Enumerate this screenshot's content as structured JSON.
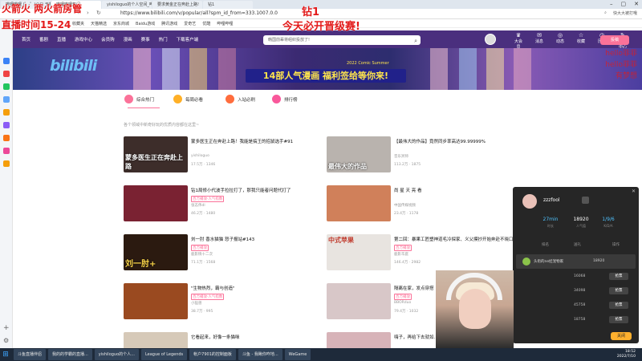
{
  "overlay": {
    "line1": "火箭火 两火箭房管",
    "line2": "直播时间15-24",
    "center1": "钻1",
    "center2": "今天必开晋级赛!",
    "watermark": [
      "hello菲菲",
      "hello菲菲",
      "有梦想"
    ]
  },
  "browser": {
    "tabs": [
      "哔哩哔哩 (゜-゜)つロ 干杯~-bilibili",
      "哔哩哔哩热门",
      "yishiloguo的个人空间_哔哩哔哩",
      "要求黄金正在奔赴上路!",
      "钻1"
    ],
    "url": "https://www.bilibili.com/v/popular/all?spm_id_from=333.1007.0.0",
    "user": "快大大被打哦",
    "bookmarks": [
      "收藏夹",
      "天猫精选",
      "京东商城",
      "Baidu游戏",
      "腾讯游戏",
      "爱奇艺",
      "优酷",
      "哔哩哔哩"
    ]
  },
  "bili": {
    "nav": [
      "首页",
      "番剧",
      "直播",
      "游戏中心",
      "会员购",
      "漫画",
      "赛事",
      "热门",
      "下载客户端"
    ],
    "search_placeholder": "韩国前辈将组织投放了!",
    "header_icons": [
      "大会员",
      "消息",
      "动态",
      "收藏",
      "历史",
      "创作中心"
    ],
    "upload": "投稿",
    "logo": "bilibili",
    "banner_slogan": "14部人气漫画 福利签给等你来!",
    "banner_small": "2022 Comic Summer",
    "categories": [
      {
        "label": "综合热门",
        "color": "#fb7299"
      },
      {
        "label": "每周必看",
        "color": "#ffb027"
      },
      {
        "label": "入站必刷",
        "color": "#ff6d3d"
      },
      {
        "label": "排行榜",
        "color": "#f9589b"
      }
    ],
    "hint": "各个领域中新奇好玩的优质内容都在这里~"
  },
  "cards": [
    {
      "title": "蒙多医生正在奔赴上路！我能是搞王的招鼠选手#91",
      "thumb": "蒙多医生正在奔赴上路",
      "tag": "",
      "up": "yishiloguo",
      "stat": "17.5万 · 1346",
      "color": "#3d2d2a"
    },
    {
      "title": "【最伟大的作品】竟然同步率高达99.99999%",
      "thumb": "最伟大的作品",
      "tag": "",
      "up": "音乐冥师",
      "stat": "113.2万 · 1875",
      "color": "#b9b3ae"
    },
    {
      "title": "钻1局修小代波手拉拉打了，那我只能者问题代打了",
      "thumb": "",
      "tag": "百万播放·人气指数",
      "up": "张志伟dl",
      "stat": "46.2万 · 1480",
      "color": "#7a2232"
    },
    {
      "title": "尚 星 天 亮 看",
      "thumb": "",
      "tag": "",
      "up": "中国传媒视频",
      "stat": "23.4万 · 1178",
      "color": "#d0805a"
    },
    {
      "title": "刘一肘 香水猫猫 怒子报站#143",
      "thumb": "刘一肘+",
      "tag": "百万播放",
      "up": "鹿影情十二次",
      "stat": "71.1万 · 1568",
      "color": "#2b1a10"
    },
    {
      "title": "第二回：暴果工匠塑神道毛冷探家、义父摸抄开始奔赴不晓口",
      "thumb": "中式苹果",
      "tag": "百万播放",
      "up": "鹿影华庭",
      "stat": "146.4万 · 2982",
      "color": "#e8e4e0"
    },
    {
      "title": "\"生物热烈，霸与创造\"",
      "thumb": "",
      "tag": "百万播放·人气指数",
      "up": "小猛兽",
      "stat": "38.7万 · 995",
      "color": "#9a4a20"
    },
    {
      "title": "隔离在家，发点穿搭",
      "thumb": "",
      "tag": "百万播放",
      "up": "BBORduo",
      "stat": "79.4万 · 1032",
      "color": "#d8c7c8"
    },
    {
      "title": "它看起来，好像一条猫咪",
      "thumb": "",
      "tag": "",
      "up": "",
      "stat": "",
      "color": "#d6c9b8"
    },
    {
      "title": "嗨子，再给下去就如...",
      "thumb": "",
      "tag": "",
      "up": "",
      "stat": "",
      "color": "#d7b3b8"
    }
  ],
  "chat": {
    "username": "zzzfool",
    "stats": [
      {
        "value": "27min",
        "label": "时长"
      },
      {
        "value": "18920",
        "label": "人气值"
      },
      {
        "value": "1/9/6",
        "label": "K/D/A"
      }
    ],
    "columns": [
      "排名",
      "",
      "送礼",
      "",
      "操作"
    ],
    "first": {
      "text": "头衔的ne娃宠物家",
      "num": "18920"
    },
    "rows": [
      {
        "num": "16068",
        "btn": "抢票"
      },
      {
        "num": "34098",
        "btn": "抢票"
      },
      {
        "num": "45758",
        "btn": "抢票"
      },
      {
        "num": "18758",
        "btn": "抢票"
      }
    ],
    "send": "关闭"
  },
  "taskbar": {
    "items": [
      "斗鱼直播伴侣",
      "我的的学霸的直播...",
      "yishiloguo的个人...",
      "League of Legends",
      "帐户7901的控制面板",
      "斗鱼 - 我瞅你咋地...",
      "WeGame"
    ],
    "time": "18:52",
    "date": "2022/7/10"
  }
}
